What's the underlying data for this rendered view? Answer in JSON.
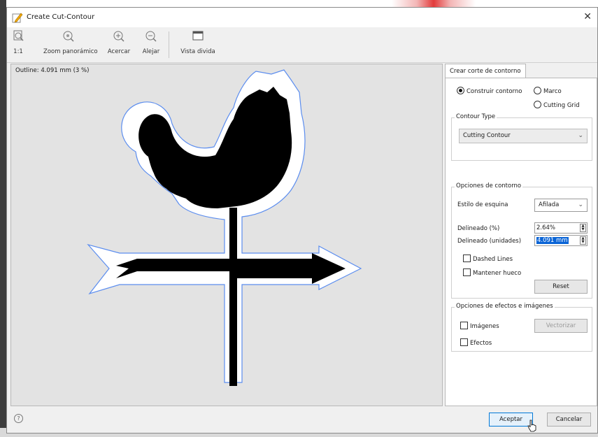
{
  "window": {
    "title": "Create Cut-Contour"
  },
  "toolbar": [
    {
      "id": "fit",
      "label": "1:1",
      "icon": "fit-page-icon"
    },
    {
      "id": "pan",
      "label": "Zoom panorámico",
      "icon": "pan-zoom-icon"
    },
    {
      "id": "zoomin",
      "label": "Acercar",
      "icon": "zoom-in-icon"
    },
    {
      "id": "zoomout",
      "label": "Alejar",
      "icon": "zoom-out-icon"
    },
    {
      "id": "split",
      "label": "Vista divida",
      "icon": "split-view-icon"
    }
  ],
  "canvas": {
    "outline_text": "Outline: 4.091 mm (3 %)"
  },
  "panel": {
    "tab": "Crear corte de contorno",
    "mode": {
      "options": [
        "Construir contorno",
        "Marco",
        "Cutting Grid"
      ],
      "selected": "Construir contorno"
    },
    "contour_type": {
      "legend": "Contour Type",
      "value": "Cutting Contour"
    },
    "contour_options": {
      "legend": "Opciones de contorno",
      "corner_style_label": "Estilo de esquina",
      "corner_style_value": "Afilada",
      "outline_pct_label": "Delineado (%)",
      "outline_pct_value": "2.64%",
      "outline_units_label": "Delineado (unidades)",
      "outline_units_value": "4.091 mm",
      "dashed_label": "Dashed Lines",
      "keep_hole_label": "Mantener hueco",
      "reset_label": "Reset"
    },
    "effects": {
      "legend": "Opciones de efectos e imágenes",
      "images_label": "Imágenes",
      "effects_label": "Efectos",
      "vectorize_label": "Vectorizar"
    }
  },
  "footer": {
    "help": "?",
    "ok_label": "Aceptar",
    "cancel_label": "Cancelar"
  },
  "colors": {
    "accent": "#0078d7",
    "selection": "#0a64d6",
    "contour": "#5b8def"
  }
}
